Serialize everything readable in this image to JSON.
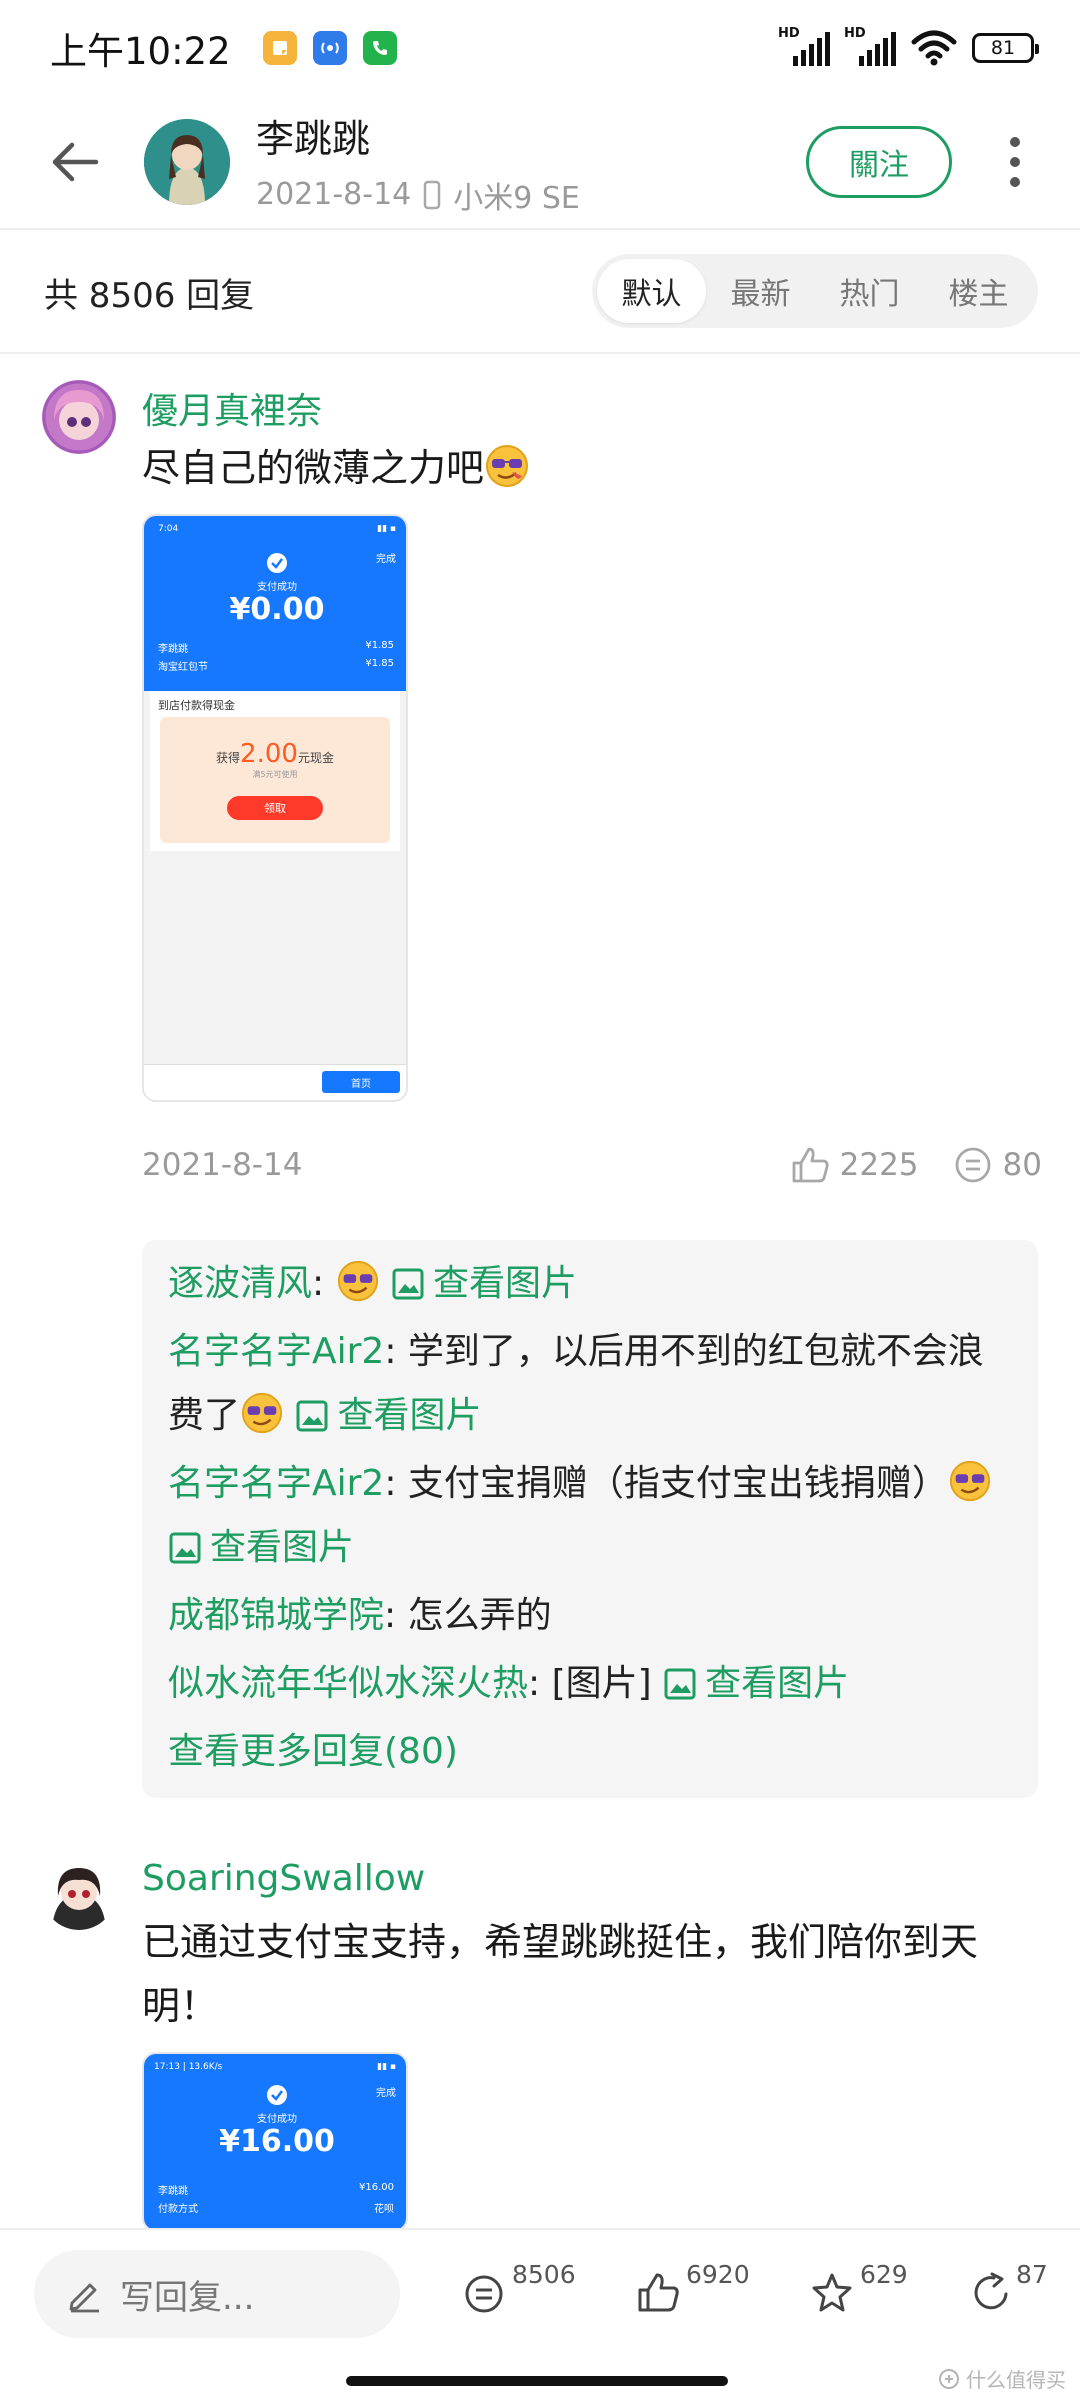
{
  "status_bar": {
    "time": "上午10:22",
    "hd1": "HD",
    "hd2": "HD",
    "battery": "81",
    "colors": {
      "app1": "#f6b43a",
      "app2": "#2f7bea",
      "app3": "#22b34d"
    }
  },
  "header": {
    "author_name": "李跳跳",
    "date": "2021-8-14",
    "device": "小米9 SE",
    "follow_label": "關注"
  },
  "reply_bar": {
    "count_text": "共 8506 回复",
    "sort_tabs": [
      "默认",
      "最新",
      "热门",
      "楼主"
    ],
    "active_tab": "默认"
  },
  "comments": [
    {
      "user": "優月真裡奈",
      "text": "尽自己的微薄之力吧",
      "screenshot": {
        "time": "7:04",
        "done": "完成",
        "title": "支付成功",
        "amount": "¥0.00",
        "row1_left": "李跳跳",
        "row1_right": "¥1.85",
        "row2_left": "淘宝红包节",
        "row2_right": "¥1.85",
        "card_title": "到店付款得现金",
        "prize_prefix": "获得",
        "prize_amount": "2.00",
        "prize_suffix": "元现金",
        "prize_note": "满5元可使用",
        "claim_button": "领取",
        "home_button": "首页"
      },
      "date": "2021-8-14",
      "likes": "2225",
      "replies": "80",
      "sub_replies": [
        {
          "user": "逐波清风",
          "sep": ": ",
          "text": "",
          "image_link": "查看图片"
        },
        {
          "user": "名字名字Air2",
          "sep": ": ",
          "text": "学到了，以后用不到的红包就不会浪费了",
          "image_link": "查看图片"
        },
        {
          "user": "名字名字Air2",
          "sep": ": ",
          "text": "支付宝捐赠（指支付宝出钱捐赠）",
          "image_link": "查看图片"
        },
        {
          "user": "成都锦城学院",
          "sep": ": ",
          "text": "怎么弄的"
        },
        {
          "user": "似水流年华似水深火热",
          "sep": ": ",
          "text": "[图片]",
          "image_link": "查看图片"
        }
      ],
      "more_replies": "查看更多回复(80)"
    },
    {
      "user": "SoaringSwallow",
      "text": "已通过支付宝支持，希望跳跳挺住，我们陪你到天明！",
      "screenshot": {
        "time": "17:13 | 13.6K/s",
        "done": "完成",
        "title": "支付成功",
        "amount": "¥16.00",
        "row1_left": "李跳跳",
        "row1_right": "¥16.00",
        "row2_left": "付款方式",
        "row2_right": "花呗"
      }
    }
  ],
  "bottom_bar": {
    "reply_placeholder": "写回复...",
    "comments_count": "8506",
    "likes_count": "6920",
    "stars_count": "629",
    "shares_count": "87",
    "watermark": "什么值得买"
  }
}
